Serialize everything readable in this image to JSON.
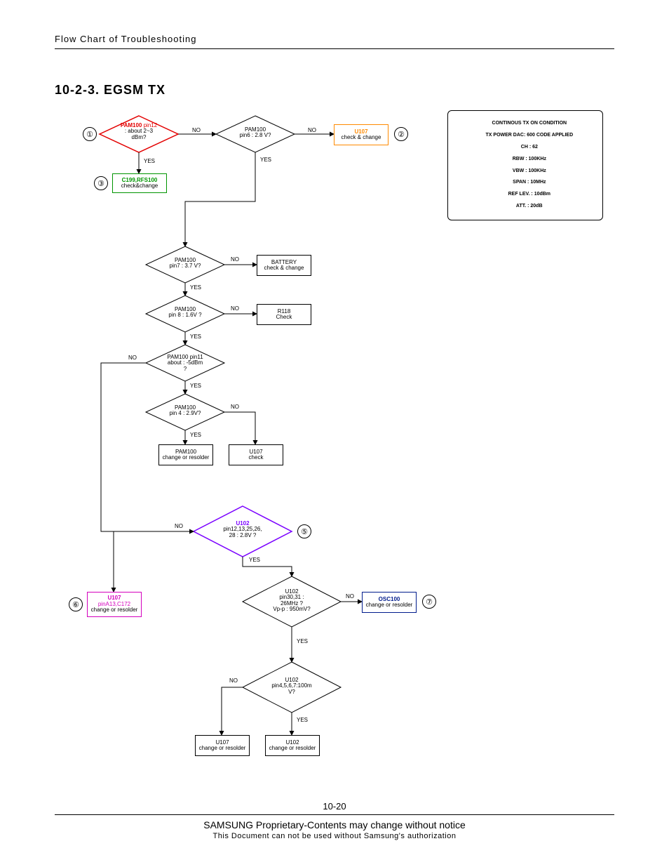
{
  "header": {
    "running_head": "Flow Chart of Troubleshooting"
  },
  "section": {
    "title": "10-2-3. EGSM TX"
  },
  "info_box": {
    "l1": "CONTINOUS TX ON CONDITION",
    "l2": "TX POWER DAC: 600 CODE APPLIED",
    "l3": "CH : 62",
    "l4": "RBW : 100KHz",
    "l5": "VBW : 100KHz",
    "l6": "SPAN : 10MHz",
    "l7": "REF LEV. : 10dBm",
    "l8": "ATT. : 20dB"
  },
  "nodes": {
    "d1_a": "PAM100",
    "d1_b": "pin12",
    "d1_c": ": about 2~3",
    "d1_d": "dBm?",
    "d2_a": "PAM100",
    "d2_b": "pin6 : 2.8 V?",
    "p2_a": "U107",
    "p2_b": "check & change",
    "p3_a": "C199,RFS100",
    "p3_b": "check&change",
    "d4_a": "PAM100",
    "d4_b": "pin7 : 3.7 V?",
    "p4_a": "BATTERY",
    "p4_b": "check & change",
    "d5_a": "PAM100",
    "d5_b": "pin 8 : 1.6V ?",
    "p5_a": "R118",
    "p5_b": "Check",
    "d6_a": "PAM100 pin11",
    "d6_b": "about : -5dBm",
    "d6_c": "?",
    "d7_a": "PAM100",
    "d7_b": "pin 4 : 2.9V?",
    "p7a_a": "PAM100",
    "p7a_b": "change or resolder",
    "p7b_a": "U107",
    "p7b_b": "check",
    "d8_a": "U102",
    "d8_b": "pin12,13,25,26,",
    "d8_c": "28 : 2.8V ?",
    "d9_a": "U102",
    "d9_b": "pin30,31 :",
    "d9_c": "26MHz ?",
    "d9_d": "Vp-p : 950mV?",
    "p9l_a": "U107",
    "p9l_b": "pinA13,C172",
    "p9l_c": "change or resolder",
    "p9r_a": "OSC100",
    "p9r_b": "change or resolder",
    "d10_a": "U102",
    "d10_b": "pin4,5,6,7:100m",
    "d10_c": "V?",
    "p10a_a": "U107",
    "p10a_b": "change or resolder",
    "p10b_a": "U102",
    "p10b_b": "change or resolder"
  },
  "labels": {
    "yes": "YES",
    "no": "NO"
  },
  "circles": {
    "c1": "①",
    "c2": "②",
    "c3": "③",
    "c5": "⑤",
    "c6": "⑥",
    "c7": "⑦"
  },
  "colors": {
    "red": "#e30000",
    "green": "#009400",
    "orange": "#ff8a00",
    "purple": "#7a00ff",
    "magenta": "#d400bd",
    "navy": "#001b8c"
  },
  "footer": {
    "page_num": "10-20",
    "line1": "SAMSUNG Proprietary-Contents may change without notice",
    "line2": "This Document can not be used without Samsung's authorization"
  }
}
